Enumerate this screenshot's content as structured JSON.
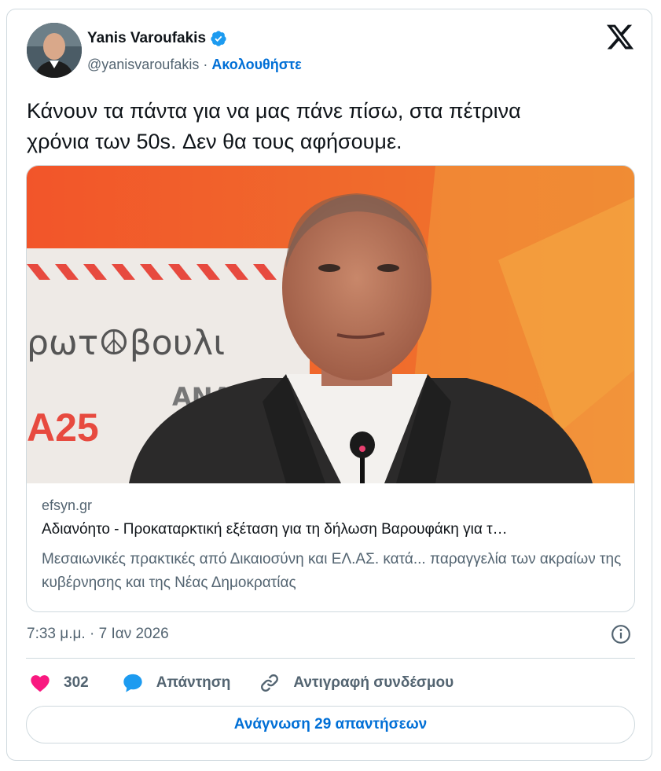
{
  "author": {
    "name": "Yanis Varoufakis",
    "handle": "@yanisvaroufakis",
    "separator": " · ",
    "follow_label": "Ακολουθήστε",
    "verified": true
  },
  "tweet": {
    "text": "Κάνουν τα πάντα για να μας πάνε πίσω, στα πέτρινα\nχρόνια των 50s. Δεν θα τους αφήσουμε."
  },
  "link_card": {
    "domain": "efsyn.gr",
    "title": "Αδιανόητο - Προκαταρκτική εξέταση για τη δήλωση Βαρουφάκη για τ…",
    "description": "Μεσαιωνικές πρακτικές από Δικαιοσύνη και ΕΛ.ΑΣ. κατά... παραγγελία των ακραίων της κυβέρνησης και της Νέας Δημοκρατίας",
    "image": {
      "banner_text": "ρωτ☮βουλι",
      "banner_text_2": "ΑΝΑΤ",
      "banner_number": "A25"
    }
  },
  "meta": {
    "timestamp": "7:33 μ.μ. · 7 Ιαν 2026"
  },
  "actions": {
    "likes": "302",
    "reply_label": "Απάντηση",
    "copy_link_label": "Αντιγραφή συνδέσμου"
  },
  "read_replies_label": "Ανάγνωση 29 απαντήσεων",
  "colors": {
    "accent": "#006fd6",
    "verified": "#1d9bf0",
    "like": "#f91880",
    "muted": "#536471",
    "border": "#cfd9de"
  },
  "icons": [
    "verified-badge-icon",
    "x-logo-icon",
    "info-icon",
    "heart-icon",
    "reply-bubble-icon",
    "link-icon"
  ]
}
